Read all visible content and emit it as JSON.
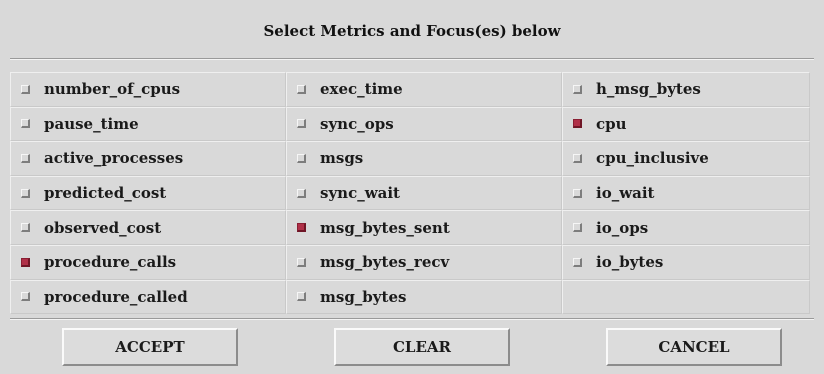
{
  "dialog": {
    "title": "Select Metrics and Focus(es) below"
  },
  "metrics": [
    {
      "label": "number_of_cpus",
      "checked": false
    },
    {
      "label": "exec_time",
      "checked": false
    },
    {
      "label": "h_msg_bytes",
      "checked": false
    },
    {
      "label": "pause_time",
      "checked": false
    },
    {
      "label": "sync_ops",
      "checked": false
    },
    {
      "label": "cpu",
      "checked": true
    },
    {
      "label": "active_processes",
      "checked": false
    },
    {
      "label": "msgs",
      "checked": false
    },
    {
      "label": "cpu_inclusive",
      "checked": false
    },
    {
      "label": "predicted_cost",
      "checked": false
    },
    {
      "label": "sync_wait",
      "checked": false
    },
    {
      "label": "io_wait",
      "checked": false
    },
    {
      "label": "observed_cost",
      "checked": false
    },
    {
      "label": "msg_bytes_sent",
      "checked": true
    },
    {
      "label": "io_ops",
      "checked": false
    },
    {
      "label": "procedure_calls",
      "checked": true
    },
    {
      "label": "msg_bytes_recv",
      "checked": false
    },
    {
      "label": "io_bytes",
      "checked": false
    },
    {
      "label": "procedure_called",
      "checked": false
    },
    {
      "label": "msg_bytes",
      "checked": false
    }
  ],
  "buttons": {
    "accept": "ACCEPT",
    "clear": "CLEAR",
    "cancel": "CANCEL"
  },
  "colors": {
    "background": "#d9d9d9",
    "checked": "#b03048"
  }
}
